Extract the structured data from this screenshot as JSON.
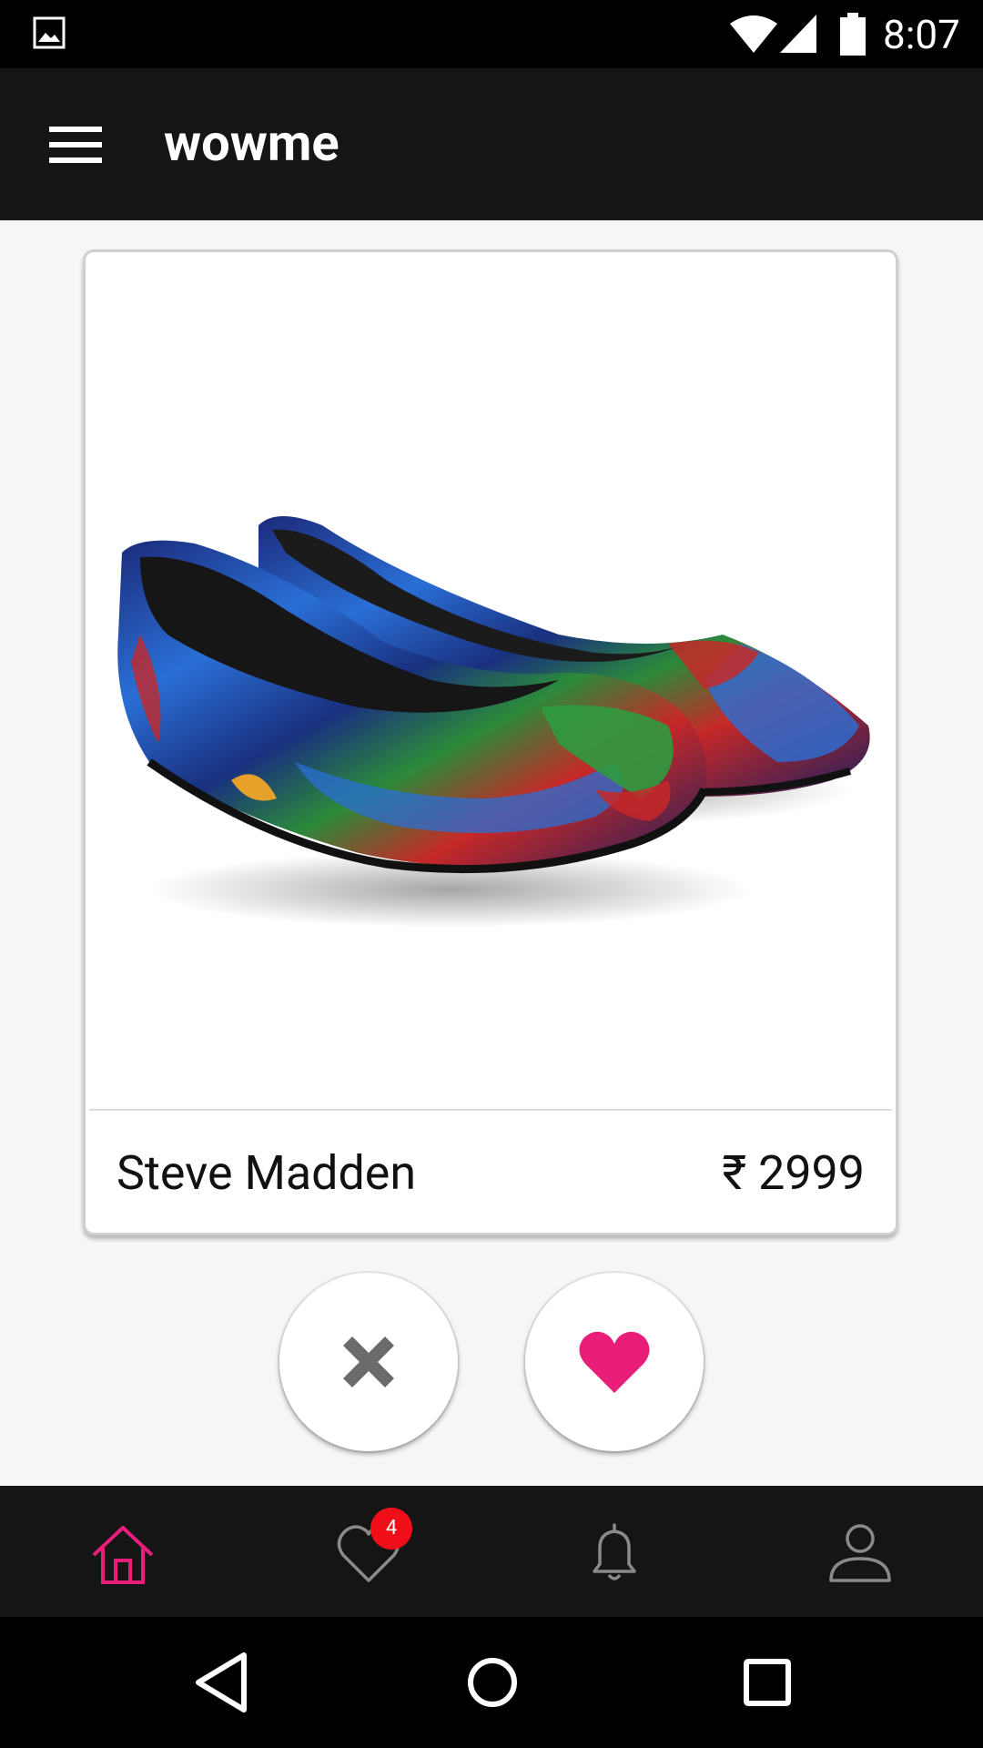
{
  "status_bar": {
    "time": "8:07",
    "icons": [
      "gallery-icon",
      "wifi-icon",
      "signal-icon",
      "battery-icon"
    ]
  },
  "app_bar": {
    "title": "wowme",
    "menu_icon": "menu-icon"
  },
  "product_card": {
    "brand": "Steve Madden",
    "price": "₹ 2999",
    "image_subject": "floral print ballet flats"
  },
  "actions": {
    "dislike_icon": "close-icon",
    "like_icon": "heart-icon"
  },
  "bottom_nav": {
    "items": [
      {
        "name": "home",
        "icon": "home-icon",
        "active": true
      },
      {
        "name": "favorites",
        "icon": "heart-outline-icon",
        "badge": "4"
      },
      {
        "name": "notifications",
        "icon": "bell-icon"
      },
      {
        "name": "profile",
        "icon": "user-icon"
      }
    ]
  },
  "colors": {
    "accent": "#e91e78",
    "app_bar": "#151515",
    "badge": "#f00f18",
    "background": "#f5f6f8"
  }
}
